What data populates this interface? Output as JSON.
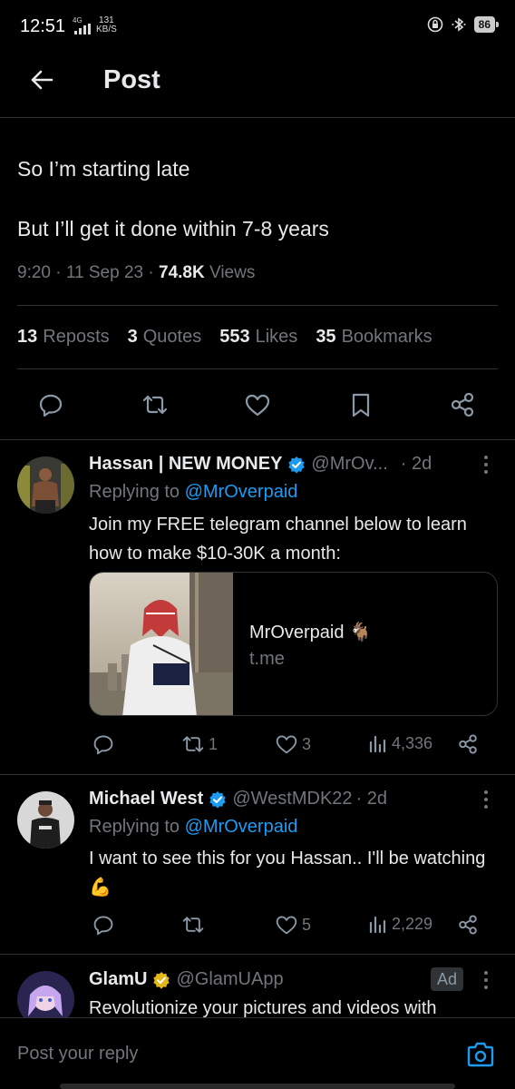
{
  "status_bar": {
    "time": "12:51",
    "network": "4G",
    "speed_value": "131",
    "speed_unit": "KB/S",
    "battery": "86"
  },
  "header": {
    "title": "Post"
  },
  "post": {
    "line1": "So I’m starting late",
    "line2": "But I’ll get it done within 7-8 years",
    "time": "9:20",
    "date": "11 Sep 23",
    "views_count": "74.8K",
    "views_label": "Views",
    "stats": [
      {
        "count": "13",
        "label": "Reposts"
      },
      {
        "count": "3",
        "label": "Quotes"
      },
      {
        "count": "553",
        "label": "Likes"
      },
      {
        "count": "35",
        "label": "Bookmarks"
      }
    ]
  },
  "replies": [
    {
      "name": "Hassan | NEW MONEY",
      "handle": "@MrOv...",
      "time": "· 2d",
      "replying_prefix": "Replying to",
      "replying_to": "@MrOverpaid",
      "body": "Join my FREE telegram channel below to learn how to make $10-30K a month:",
      "card_title": "MrOverpaid 🐐",
      "card_domain": "t.me",
      "reposts": "1",
      "likes": "3",
      "views": "4,336"
    },
    {
      "name": "Michael West",
      "handle": "@WestMDK22",
      "time": "· 2d",
      "replying_prefix": "Replying to",
      "replying_to": "@MrOverpaid",
      "body": "I want to see this for you Hassan.. I'll be watching 💪",
      "reposts": "",
      "likes": "5",
      "views": "2,229"
    },
    {
      "name": "GlamU",
      "handle": "@GlamUApp",
      "ad_label": "Ad",
      "body": "Revolutionize your pictures and videos with"
    }
  ],
  "reply_bar": {
    "placeholder": "Post your reply"
  },
  "colors": {
    "background": "#000000",
    "text": "#e7e9ea",
    "muted": "#71767b",
    "accent": "#1d9bf0",
    "divider": "#2f3336",
    "gold_verified": "#e2b719"
  },
  "icons": [
    "back-arrow-icon",
    "reply-icon",
    "repost-icon",
    "like-icon",
    "bookmark-icon",
    "share-icon",
    "more-icon",
    "views-icon",
    "verified-icon",
    "camera-icon"
  ]
}
